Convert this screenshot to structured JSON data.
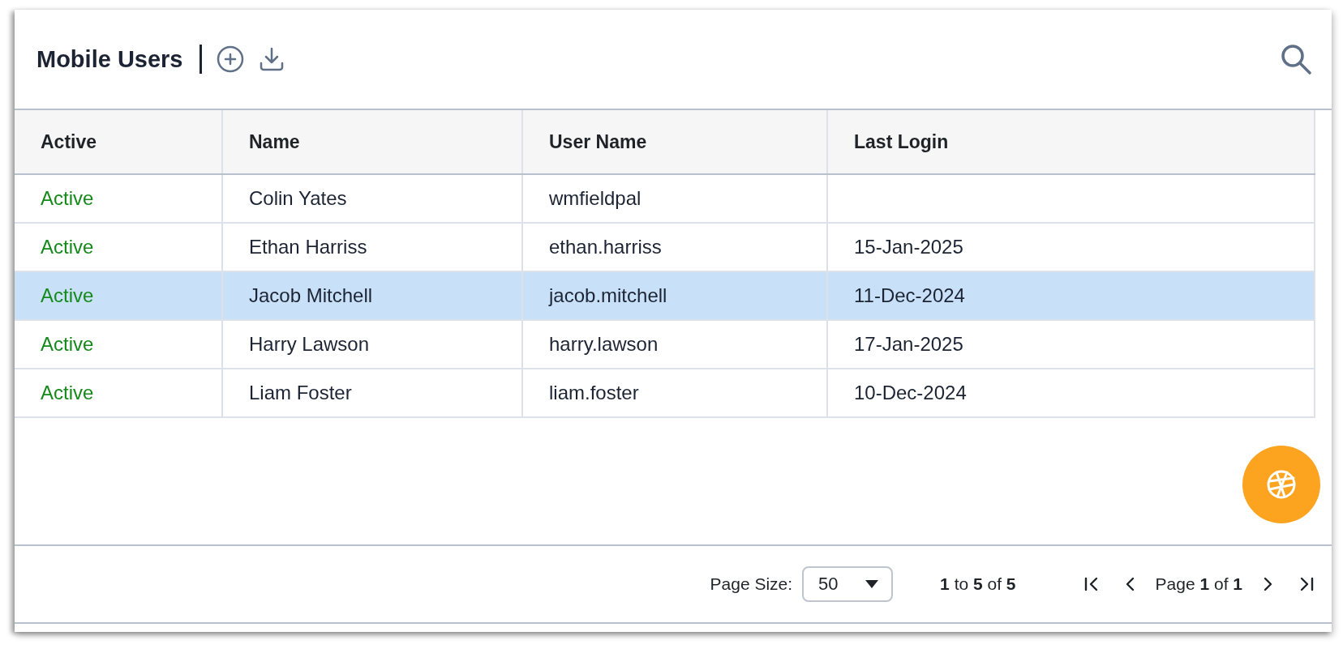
{
  "header": {
    "title": "Mobile Users"
  },
  "table": {
    "columns": [
      {
        "label": "Active",
        "kind": "status"
      },
      {
        "label": "Name",
        "kind": "text"
      },
      {
        "label": "User Name",
        "kind": "text"
      },
      {
        "label": "Last Login",
        "kind": "text"
      }
    ],
    "rows": [
      {
        "cells": [
          "Active",
          "Colin Yates",
          "wmfieldpal",
          ""
        ],
        "selected": false
      },
      {
        "cells": [
          "Active",
          "Ethan Harriss",
          "ethan.harriss",
          "15-Jan-2025"
        ],
        "selected": false
      },
      {
        "cells": [
          "Active",
          "Jacob Mitchell",
          "jacob.mitchell",
          "11-Dec-2024"
        ],
        "selected": true
      },
      {
        "cells": [
          "Active",
          "Harry Lawson",
          "harry.lawson",
          "17-Jan-2025"
        ],
        "selected": false
      },
      {
        "cells": [
          "Active",
          "Liam Foster",
          "liam.foster",
          "10-Dec-2024"
        ],
        "selected": false
      }
    ]
  },
  "pager": {
    "page_size_label": "Page Size:",
    "page_size": "50",
    "range": "**1** to **5** of **5**",
    "page": "Page **1** of **1**"
  }
}
